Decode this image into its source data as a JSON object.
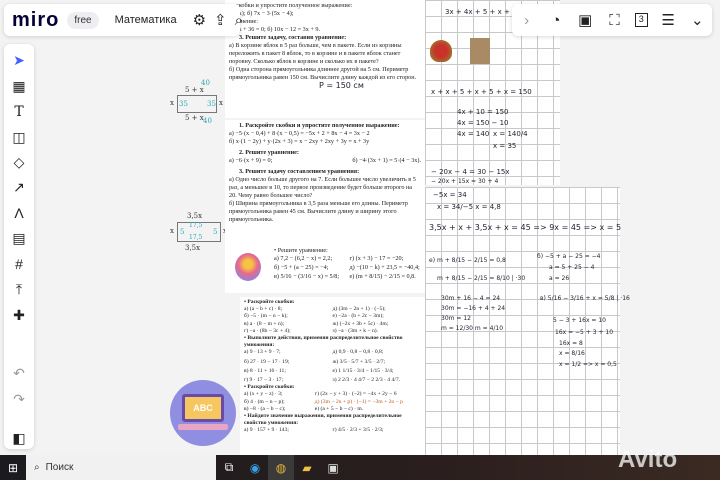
{
  "topbar": {
    "logo": "miro",
    "plan": "free",
    "board_name": "Математика",
    "icons": [
      "gear-icon",
      "upload-icon",
      "search-icon"
    ]
  },
  "left_toolbar": {
    "icons": [
      "cursor-icon",
      "template-icon",
      "text-icon",
      "sticky-note-icon",
      "shapes-icon",
      "arrow-icon",
      "pen-icon",
      "comment-icon",
      "frame-icon",
      "upload-icon",
      "add-icon",
      "undo-icon",
      "redo-icon",
      "panel-icon"
    ]
  },
  "right_toolbar": {
    "icons": [
      "chevron-right-icon",
      "timer-icon",
      "share-screen-icon",
      "focus-icon",
      "counter-icon",
      "notes-icon",
      "chevron-double-down-icon"
    ],
    "counter": "3"
  },
  "doc_top": {
    "lines": [
      "те скобки и упростите полученное выражение:",
      "8 − x);        б) 7x − 3·(5x − 4);",
      "уравнение:",
      "а) 9x + 36 = 0;        б) 10x − 12 = 3x + 9."
    ],
    "task3_title": "3. Решите задачу, составив уравнение:",
    "task3_a": "а) В корзине яблок в 5 раз больше, чем в пакете. Если из корзины переложить в пакет 8 яблок, то в корзине и в пакете яблок станет поровну. Сколько яблок в корзине и сколько их в пакете?",
    "task3_b": "б) Одна сторона прямоугольника длиннее другой на 5 см. Периметр прямоугольника равен 150 см. Вычислите длину каждой из его сторон.",
    "handwritten": "P = 150 см"
  },
  "doc_mid": {
    "t1": "1. Раскройте скобки и упростите полученное выражение:",
    "t1a": "а) −5·(x − 0,4) + 8·(x − 0,5) = −5x + 2 + 8x − 4 = 3x − 2",
    "t1b": "б) x·(1 − 2y) + y·(2x + 3) = x − 2xy + 2xy + 3y = x + 3y",
    "t2": "2. Решите уравнение:",
    "t2a": "а) −6·(x + 9) = 0;",
    "t2b": "б) −4·(3x + 1) = 5·(4 − 3x).",
    "t3": "3. Решите задачу составлением уравнения:",
    "t3a": "а) Одно число больше другого на 7. Если большее число увеличить в 5 раз, а меньшее в 10, то первое произведение будет больше второго на 20. Чему равно большее число?",
    "t3b": "б) Ширина прямоугольника в 3,5 раза меньше его длины. Периметр прямоугольника равен 45 см. Вычислите длину и ширину этого прямоугольника."
  },
  "doc_eq": {
    "title": "• Решите уравнение:",
    "items": [
      "а) 7,2 − (6,2 − x) = 2,2;",
      "г) (x + 3) − 17 = −20;",
      "б) −5 + (a − 25) = −4;",
      "д) −(10 − k) + 23,5 = −40,4;",
      "в) 5/16 − (3/16 − x) = 5/8;",
      "е) (m + 8/15) − 2/15 = 0,8."
    ]
  },
  "doc_low": {
    "s1": "• Раскройте скобки:",
    "s1_items": [
      "а) (a − b + c) · 8;",
      "д) (3m − 2n + 1) · (−5);",
      "б) −5 · (m − n − k);",
      "е) −2a · (b + 2c − 3m);",
      "в) a · (8 − m + n);",
      "ж) (−2x + 3b + 5c) · 4m;",
      "г) −a · (8b − 3c + 4);",
      "з) −a · (3m + k − n)."
    ],
    "s2": "• Выполните действия, применяя распределительное свойство умножения:",
    "s2_items": [
      "а) 9 · 13 + 9 · 7;",
      "д) 0,9 · 0,8 − 0,8 · 0,8;",
      "б) 27 · 19 − 17 · 19;",
      "ж) 3/5 · 5/7 + 3/5 · 2/7;",
      "в) 8 · 11 + 16 · 11;",
      "е) 1 1/15 · 3/4 − 1/15 · 3/4;",
      "г) 9 · 17 − 3 · 17;",
      "з) 2 2/3 · 4 4/7 − 2 2/3 · 4 4/7."
    ],
    "s3": "• Раскройте скобки:",
    "s3_items": [
      "а) (x + y − z) · 3;",
      "г) (2x − y + 3) · (−2) = −4x + 2y − 6",
      "б) 4 · (m − n − p);",
      "д) (3m − 2n + p) · (−1) = −3m + 2n − p",
      "в) −8 · (a − b − c);",
      "е) (a + 5 − b − c) · m."
    ],
    "s4": "• Найдите значение выражения, применяя распределительное свойство умножения:",
    "s4_items": [
      "а) 9 · 157 + 9 · 143;",
      "г) 4/5 · 2/3 + 3/5 · 2/3;"
    ],
    "sticker_text": "ABC"
  },
  "rects": {
    "r1": {
      "top": "5 + x",
      "bottom": "5 + x",
      "left": "x",
      "right": "x",
      "top_val": "40",
      "bottom_val": "40",
      "left_val": "35",
      "right_val": "35"
    },
    "r2": {
      "top": "3,5x",
      "bottom": "3,5x",
      "left": "x",
      "right": "x",
      "top_val": "17,5",
      "bottom_val": "17,5",
      "left_val": "5",
      "right_val": "5"
    }
  },
  "grid_top": {
    "l0": "3x + 4x + 5 + x + 6",
    "l1": "x + x + 5 + x + 5 + x = 150",
    "l2": "4x + 10 = 150",
    "l3": "4x = 150 − 10",
    "l4": "4x = 140",
    "l5": "x = 140/4",
    "l6": "x = 35",
    "l7": "− 20x − 4 = 30 − 15x",
    "l8": "− 20x + 15x = 30 + 4"
  },
  "grid_bottom": {
    "l1": "−5x = 34",
    "l2": "x = 34/−5    x = 4,8",
    "l3": "3,5x + x + 3,5x + x = 45  =>  9x = 45  =>  x = 5",
    "e1": "е) m + 8/15 − 2/15 = 0,8",
    "e2": "m + 8/15 − 2/15 = 8/10   | ·30",
    "e3": "30m + 16 − 4 = 24",
    "e4": "30m = −16 + 4 + 24",
    "e5": "30m = 12",
    "e6": "m = 12/30    m = 4/10",
    "b1": "б) −5 + a − 25 = −4",
    "b2": "a = 5 + 25 − 4",
    "b3": "a = 26",
    "v1": "в) 5/16 − 3/16 + x = 5/8   | ·16",
    "v2": "5 − 3 + 16x = 10",
    "v3": "16x = −5 + 3 + 10",
    "v4": "16x = 8",
    "v5": "x = 8/16",
    "v6": "x = 1/2  =>  x = 0,5"
  },
  "taskbar": {
    "search_placeholder": "Поиск",
    "icons": [
      "windows-icon",
      "search-icon",
      "task-view-icon",
      "edge-icon",
      "chrome-icon",
      "explorer-icon",
      "store-icon"
    ]
  },
  "watermark": "Avito"
}
